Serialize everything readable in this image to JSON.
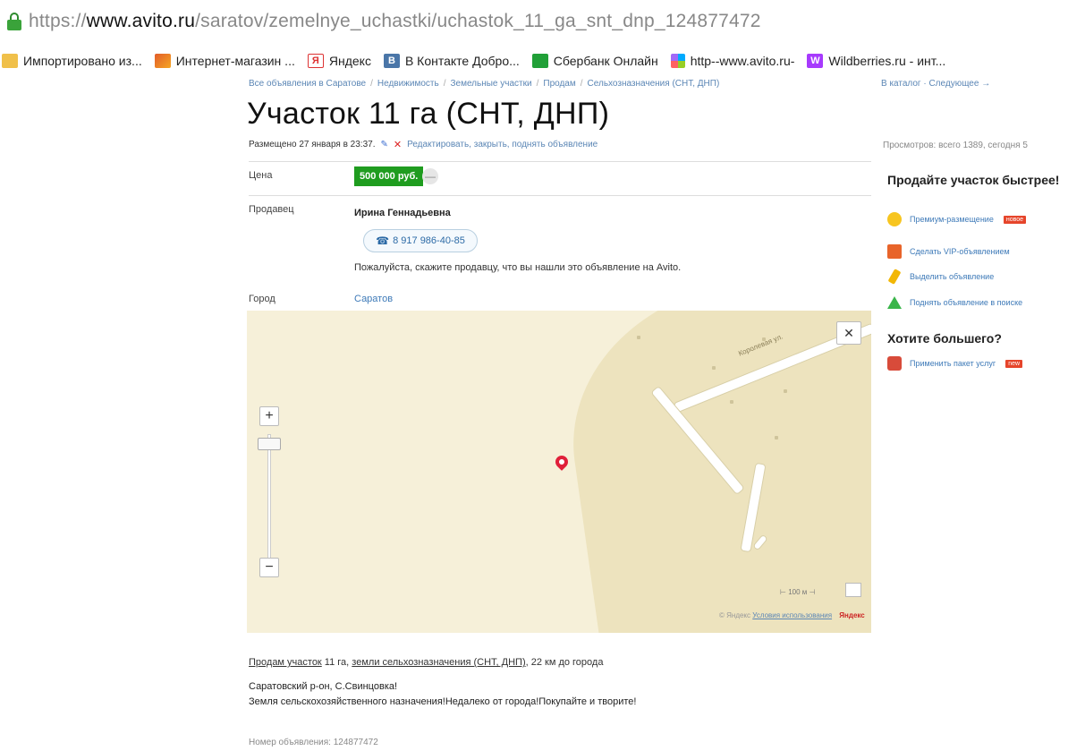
{
  "browser": {
    "url_scheme": "https://",
    "url_host": "www.avito.ru",
    "url_path": "/saratov/zemelnye_uchastki/uchastok_11_ga_snt_dnp_124877472",
    "bookmarks": [
      {
        "label": "Импортировано из...",
        "icon": "folder-icon"
      },
      {
        "label": "Интернет-магазин ...",
        "icon": "shop-icon"
      },
      {
        "label": "Яндекс",
        "icon": "yandex-icon"
      },
      {
        "label": "В Контакте Добро...",
        "icon": "vk-icon"
      },
      {
        "label": "Сбербанк Онлайн",
        "icon": "sberbank-icon"
      },
      {
        "label": "http--www.avito.ru-",
        "icon": "avito-icon"
      },
      {
        "label": "Wildberries.ru - инт...",
        "icon": "wildberries-icon"
      }
    ]
  },
  "breadcrumbs": {
    "items": [
      "Все объявления в Саратове",
      "Недвижимость",
      "Земельные участки",
      "Продам",
      "Сельхозназначения (СНТ, ДНП)"
    ],
    "right": "В каталог · Следующее →"
  },
  "listing": {
    "title": "Участок 11 га (СНТ, ДНП)",
    "posted": "Размещено 27 января в 23:37.",
    "edit_link": "Редактировать, закрыть, поднять объявление",
    "views": "Просмотров: всего 1389, сегодня 5",
    "price_label": "Цена",
    "price": "500 000 руб.",
    "price_toggle": "—",
    "seller_label": "Продавец",
    "seller_name": "Ирина Геннадьевна",
    "phone": "8 917 986-40-85",
    "seller_note": "Пожалуйста, скажите продавцу, что вы нашли это объявление на Avito.",
    "city_label": "Город",
    "city": "Саратов"
  },
  "map": {
    "zoom_in": "+",
    "zoom_out": "−",
    "close": "✕",
    "street_label": "Королевая ул.",
    "scale": "100 м",
    "copyright": "© Яндекс",
    "terms_link": "Условия использования",
    "brand": "Яндекс"
  },
  "sidebar": {
    "sell_heading": "Продайте участок быстрее!",
    "sell_items": [
      {
        "label": "Премиум-размещение",
        "badge": "новое",
        "icon": "star-icon"
      },
      {
        "label": "Сделать VIP-объявлением",
        "badge": "",
        "icon": "vip-icon"
      },
      {
        "label": "Выделить объявление",
        "badge": "",
        "icon": "marker-icon"
      },
      {
        "label": "Поднять объявление в поиске",
        "badge": "",
        "icon": "up-arrow-icon"
      }
    ],
    "more_heading": "Хотите большего?",
    "more_items": [
      {
        "label": "Применить пакет услуг",
        "badge": "new",
        "icon": "package-icon"
      }
    ]
  },
  "description": {
    "title_link_1": "Продам участок",
    "title_mid": " 11 га, ",
    "title_link_2": "земли сельхозназначения (СНТ, ДНП)",
    "title_end": ", 22 км до города",
    "location": "Саратовский р-он, С.Свинцовка!",
    "text": "Земля сельскохозяйственного назначения!Недалеко от города!Покупайте и творите!",
    "ad_number": "Номер объявления: 124877472"
  },
  "colors": {
    "price_bg": "#1f9c1f",
    "link": "#3e7ab8",
    "map_bg": "#f6f0d9",
    "pin": "#e0203a"
  }
}
